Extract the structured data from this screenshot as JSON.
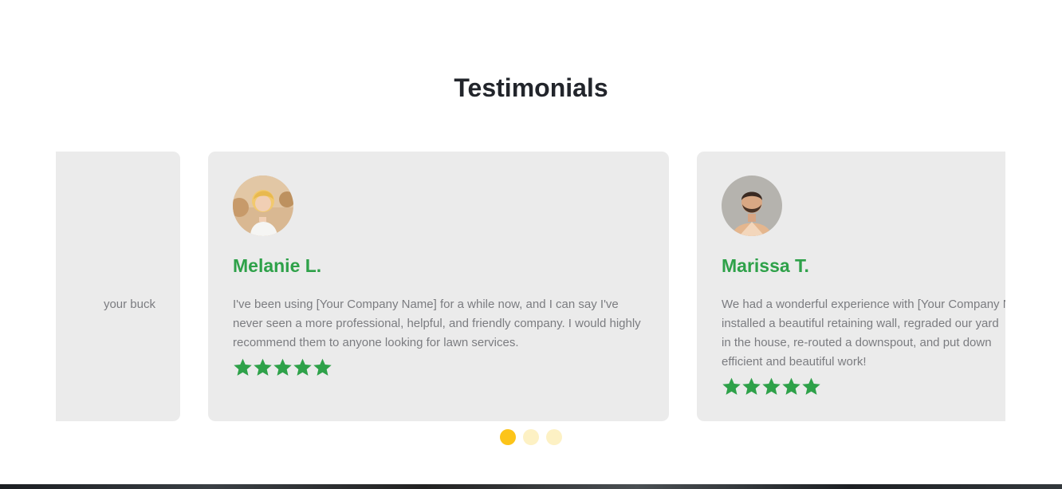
{
  "section": {
    "title": "Testimonials"
  },
  "testimonials": [
    {
      "name": "",
      "text": "your buck",
      "rating": 5,
      "show_stars": false
    },
    {
      "name": "Melanie L.",
      "text": "I've been using [Your Company Name] for a while now, and I can say I've never seen a more professional, helpful, and friendly company. I would highly recommend them to  anyone looking for lawn services.",
      "rating": 5,
      "show_stars": true
    },
    {
      "name": "Marissa T.",
      "lines": [
        "We had a wonderful experience with [Your Company Name]. They",
        "installed a beautiful retaining wall, regraded our yard",
        "in the house, re-routed a downspout, and put down",
        "efficient and beautiful work!"
      ],
      "rating": 5,
      "show_stars": true
    }
  ],
  "pagination": {
    "total": 3,
    "active": 0
  },
  "colors": {
    "accent_green": "#2ea149",
    "dot_active": "#fcc419",
    "dot_inactive": "#fdf1c4",
    "card_bg": "#ebebeb"
  },
  "icons": {
    "star": "star-icon"
  }
}
